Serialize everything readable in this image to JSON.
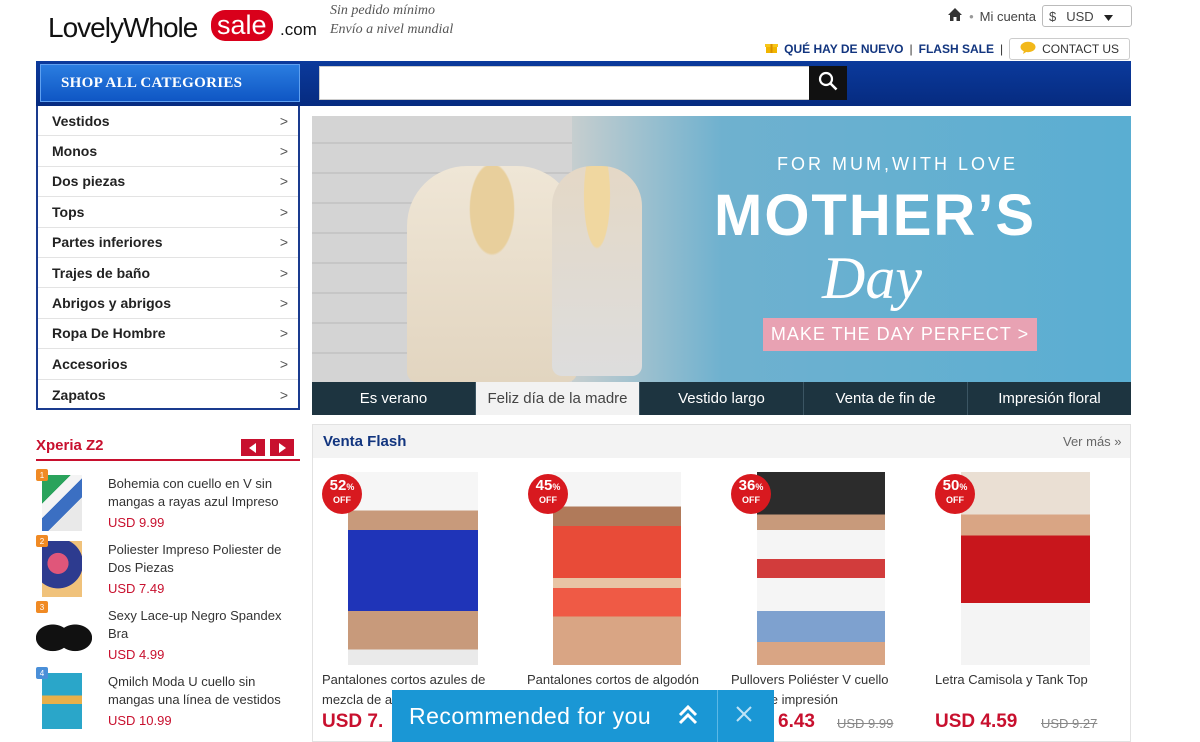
{
  "header": {
    "logo_part1": "LovelyWhole",
    "logo_part2": "sale",
    "logo_part3": ".com",
    "tagline1": "Sin pedido mínimo",
    "tagline2": "Envío a nivel mundial",
    "account_label": "Mi cuenta",
    "currency_symbol": "$",
    "currency_code": "USD",
    "whats_new": "QUÉ HAY DE NUEVO",
    "flash_sale": "FLASH SALE",
    "contact_us": "CONTACT US"
  },
  "nav": {
    "shop_all": "SHOP ALL CATEGORIES",
    "search_placeholder": ""
  },
  "categories": [
    {
      "label": "Vestidos"
    },
    {
      "label": "Monos"
    },
    {
      "label": "Dos piezas"
    },
    {
      "label": "Tops"
    },
    {
      "label": "Partes inferiores"
    },
    {
      "label": "Trajes de baño"
    },
    {
      "label": "Abrigos y abrigos"
    },
    {
      "label": "Ropa De Hombre"
    },
    {
      "label": "Accesorios"
    },
    {
      "label": "Zapatos"
    }
  ],
  "banner": {
    "subtitle": "FOR MUM,WITH LOVE",
    "title": "MOTHER’S",
    "script": "Day",
    "cta": "MAKE THE DAY PERFECT >",
    "tabs": [
      {
        "label": "Es verano",
        "active": false
      },
      {
        "label": "Feliz día de la madre",
        "active": true
      },
      {
        "label": "Vestido largo",
        "active": false
      },
      {
        "label": "Venta de fin de",
        "active": false
      },
      {
        "label": "Impresión floral",
        "active": false
      }
    ]
  },
  "sidebar_list": {
    "title": "Xperia Z2",
    "items": [
      {
        "badge": "1",
        "name": "Bohemia con cuello en V sin mangas a rayas azul Impreso",
        "price": "USD 9.99"
      },
      {
        "badge": "2",
        "name": "Poliester Impreso Poliester de Dos Piezas",
        "price": "USD 7.49"
      },
      {
        "badge": "3",
        "name": "Sexy Lace-up Negro Spandex Bra",
        "price": "USD 4.99"
      },
      {
        "badge": "4",
        "name": "Qmilch Moda U cuello sin mangas una línea de vestidos",
        "price": "USD 10.99"
      }
    ]
  },
  "flash": {
    "title": "Venta Flash",
    "more": "Ver más »",
    "products": [
      {
        "discount": "52",
        "off": "OFF",
        "name": "Pantalones cortos azules de mezcla de a",
        "price": "USD 7.",
        "old_price": ""
      },
      {
        "discount": "45",
        "off": "OFF",
        "name": "Pantalones cortos de algodón",
        "price": "",
        "old_price": ""
      },
      {
        "discount": "36",
        "off": "OFF",
        "name": "Pullovers Poliéster V cuello corta de impresión",
        "price": "6.43",
        "old_price": "USD 9.99"
      },
      {
        "discount": "50",
        "off": "OFF",
        "name": "Letra Camisola y Tank Top",
        "price": "USD 4.59",
        "old_price": "USD 9.27"
      }
    ]
  },
  "popup": {
    "label": "Recommended for you"
  },
  "colors": {
    "brand_blue": "#0b3a9c",
    "accent_red": "#c8102e",
    "popup_blue": "#1a97d5"
  }
}
